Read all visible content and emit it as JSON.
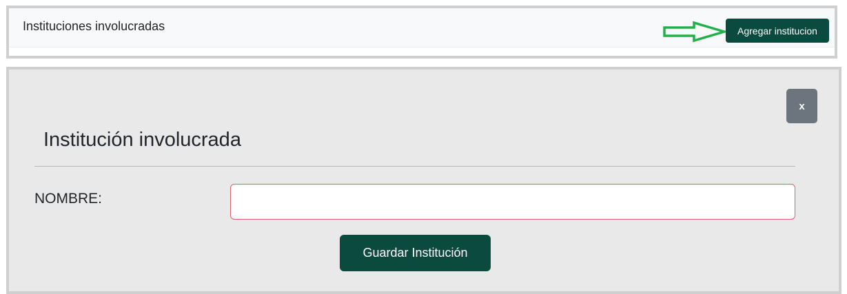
{
  "header": {
    "title": "Instituciones involucradas",
    "add_button_label": "Agregar institucion",
    "arrow_icon": "arrow-right-icon",
    "arrow_color": "#22b04a",
    "button_color": "#0b4a3e"
  },
  "modal": {
    "close_label": "x",
    "title": "Institución involucrada",
    "name_label": "NOMBRE:",
    "name_value": "",
    "name_placeholder": "",
    "save_label": "Guardar Institución",
    "invalid_border_color": "#e35d6a"
  }
}
